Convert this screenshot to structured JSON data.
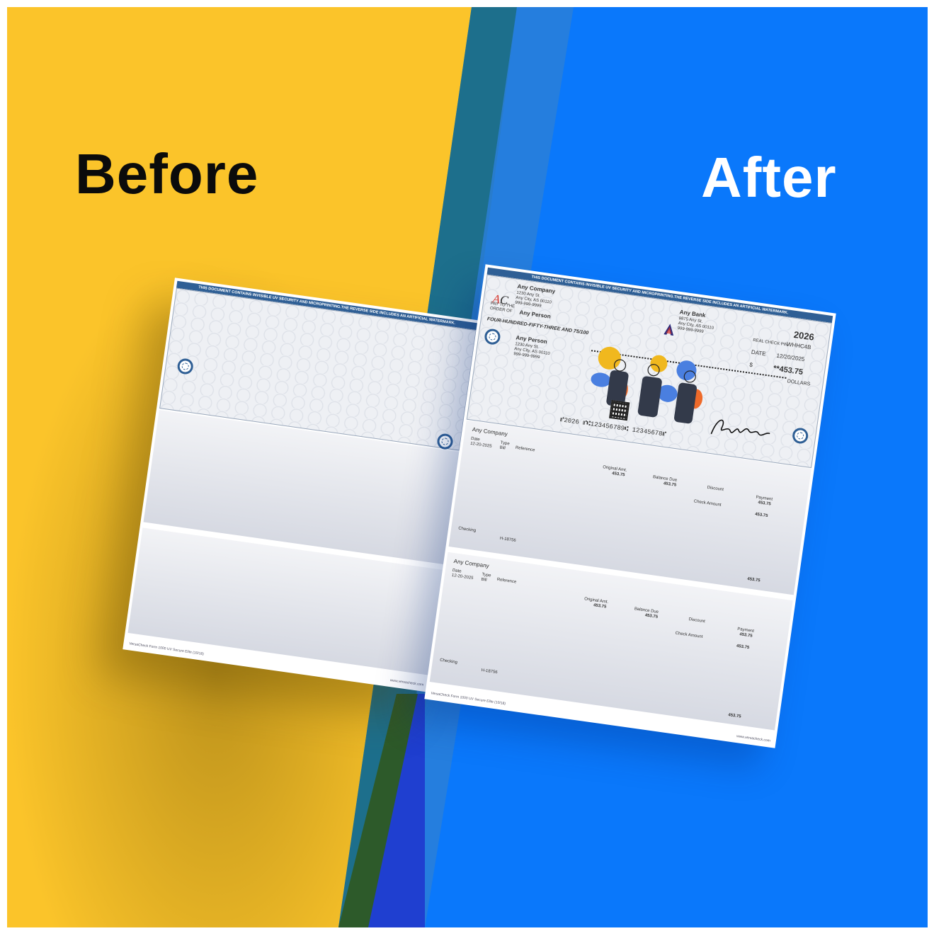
{
  "colors": {
    "yellow": "#fbc42a",
    "blue": "#0a78fb",
    "teal": "#1d6f8c",
    "check_blue": "#2f5f95"
  },
  "before": {
    "title": "Before",
    "banner": "THIS DOCUMENT CONTAINS INVISIBLE UV SECURITY AND MICROPRINTING.THE REVERSE SIDE INCLUDES AN ARTIFICIAL WATERMARK.",
    "footer_left": "VersaCheck Form 1000 UV Secure Elite (10/18)",
    "footer_right": "www.versacheck.com"
  },
  "after": {
    "title": "After",
    "banner": "THIS DOCUMENT CONTAINS INVISIBLE UV SECURITY AND MICROPRINTING.THE REVERSE SIDE INCLUDES AN ARTIFICIAL WATERMARK.",
    "company_logo": "AC",
    "company": {
      "name": "Any Company",
      "address1": "1230 Any St.",
      "address2": "Any City, AS 00110",
      "phone": "999-999-9999"
    },
    "bank": {
      "name": "Any Bank",
      "address1": "9875 Any St.",
      "address2": "Any City, AS 00110",
      "phone": "999-999-9999"
    },
    "check_number": "2026",
    "real_check_pin_label": "REAL CHECK PIN",
    "real_check_pin": "WHHC4B",
    "pay_to_label_1": "PAY TO THE",
    "pay_to_label_2": "ORDER OF",
    "payee": "Any Person",
    "amount_words": "FOUR-HUNDRED-FIFTY-THREE AND 75/100",
    "date_label": "DATE",
    "date": "12/20/2025",
    "dollar_sign": "$",
    "amount": "**453.75",
    "dollars_label": "DOLLARS",
    "recipient": {
      "name": "Any Person",
      "address1": "1230 Any St.",
      "address2": "Any City, AS 00110",
      "phone": "999-999-9999"
    },
    "micr": "⑈2026 ⑈⑆123456789⑆ 12345678⑈",
    "stubs": [
      {
        "company": "Any Company",
        "date_label": "Date",
        "date": "12-20-2025",
        "type_label": "Type",
        "type": "Bill",
        "reference_label": "Reference",
        "original_amt_label": "Original Amt.",
        "original_amt": "453.75",
        "balance_due_label": "Balance Due",
        "balance_due": "453.75",
        "discount_label": "Discount",
        "payment_label": "Payment",
        "payment": "453.75",
        "check_amount_label": "Check Amount",
        "check_amount": "453.75",
        "account": "Checking",
        "account_ref": "H-18756",
        "total": "453.75"
      },
      {
        "company": "Any Company",
        "date_label": "Date",
        "date": "12-20-2025",
        "type_label": "Type",
        "type": "Bill",
        "reference_label": "Reference",
        "original_amt_label": "Original Amt.",
        "original_amt": "453.75",
        "balance_due_label": "Balance Due",
        "balance_due": "453.75",
        "discount_label": "Discount",
        "payment_label": "Payment",
        "payment": "453.75",
        "check_amount_label": "Check Amount",
        "check_amount": "453.75",
        "account": "Checking",
        "account_ref": "H-18756",
        "total": "453.75"
      }
    ],
    "footer_left": "VersaCheck Form 1000 UV Secure Elite (10/18)",
    "footer_right": "www.versacheck.com"
  }
}
